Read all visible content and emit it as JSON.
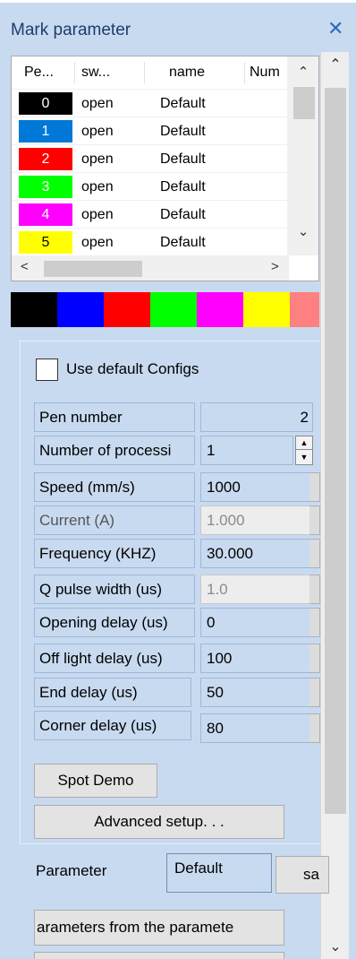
{
  "window": {
    "title": "Mark parameter",
    "close_glyph": "✕"
  },
  "pen_table": {
    "columns": [
      "Pe...",
      "sw...",
      "name",
      "Num"
    ],
    "rows": [
      {
        "index": "0",
        "switch": "open",
        "name": "Default",
        "color": "#000000"
      },
      {
        "index": "1",
        "switch": "open",
        "name": "Default",
        "color": "#0078d7"
      },
      {
        "index": "2",
        "switch": "open",
        "name": "Default",
        "color": "#ff0000"
      },
      {
        "index": "3",
        "switch": "open",
        "name": "Default",
        "color": "#00ff00"
      },
      {
        "index": "4",
        "switch": "open",
        "name": "Default",
        "color": "#ff00ff"
      },
      {
        "index": "5",
        "switch": "open",
        "name": "Default",
        "color": "#ffff00"
      }
    ]
  },
  "color_strip": [
    "#000000",
    "#0000ff",
    "#ff0000",
    "#00ff00",
    "#ff00ff",
    "#ffff00",
    "#ff8080"
  ],
  "use_default_configs": {
    "label": "Use default Configs",
    "checked": false
  },
  "params": {
    "pen_number": {
      "label": "Pen number",
      "value": "2"
    },
    "num_processing": {
      "label": "Number of processi",
      "value": "1"
    },
    "speed": {
      "label": "Speed (mm/s)",
      "value": "1000"
    },
    "current": {
      "label": "Current (A)",
      "value": "1.000"
    },
    "frequency": {
      "label": "Frequency (KHZ)",
      "value": "30.000"
    },
    "q_pulse": {
      "label": "Q pulse width (us)",
      "value": "1.0"
    },
    "opening_delay": {
      "label": "Opening delay (us)",
      "value": "0"
    },
    "off_light_delay": {
      "label": "Off light delay (us)",
      "value": "100"
    },
    "end_delay": {
      "label": "End delay (us)",
      "value": "50"
    },
    "corner_delay": {
      "label": "Corner delay (us)",
      "value": "80"
    }
  },
  "buttons": {
    "spot_demo": "Spot Demo",
    "advanced_setup": "Advanced setup. . .",
    "save_partial": "sa",
    "from_library": "arameters from the paramete"
  },
  "parameter_section": {
    "label": "Parameter",
    "value": "Default"
  },
  "icons": {
    "up": "⌃",
    "down": "⌄",
    "left": "<",
    "right": ">",
    "stepper_up": "▲",
    "stepper_down": "▼"
  }
}
